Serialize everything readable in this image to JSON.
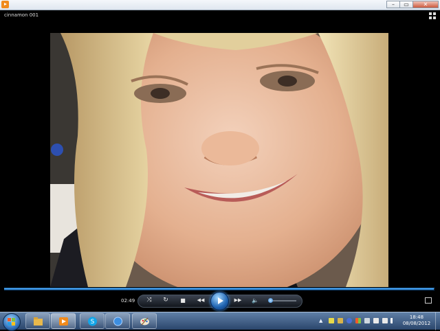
{
  "window": {
    "video_title": "cinnamon 001",
    "buttons": {
      "minimize": "–",
      "maximize": "▭",
      "close": "✕"
    }
  },
  "player": {
    "time": "02:49",
    "progress_fraction": 0.999,
    "volume_fraction": 0.05,
    "controls": {
      "shuffle": "⤨",
      "repeat": "↻",
      "stop": "■",
      "previous": "◀◀",
      "next": "▶▶",
      "mute": "🔈"
    },
    "accent_color": "#2b7dd1"
  },
  "taskbar": {
    "pinned": [
      "windows-explorer-icon",
      "media-player-icon",
      "skype-icon",
      "browser-icon",
      "paint-icon"
    ],
    "clock": {
      "time": "18:48",
      "date": "08/08/2012"
    },
    "tray_arrow": "▲"
  }
}
